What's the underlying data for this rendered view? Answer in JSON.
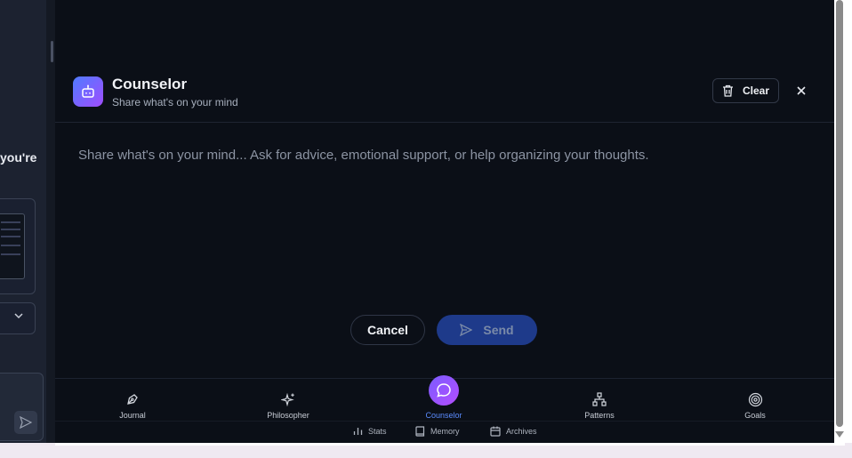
{
  "left_panel": {
    "partial_text": "you're"
  },
  "header": {
    "title": "Counselor",
    "subtitle": "Share what's on your mind",
    "clear_label": "Clear"
  },
  "composer": {
    "placeholder": "Share what's on your mind... Ask for advice, emotional support, or help organizing your thoughts.",
    "value": ""
  },
  "actions": {
    "cancel_label": "Cancel",
    "send_label": "Send"
  },
  "nav": {
    "items": [
      {
        "label": "Journal",
        "icon": "pen-nib-icon"
      },
      {
        "label": "Philosopher",
        "icon": "sparkles-icon"
      },
      {
        "label": "Counselor",
        "icon": "chat-bubble-icon",
        "active": true
      },
      {
        "label": "Patterns",
        "icon": "network-icon"
      },
      {
        "label": "Goals",
        "icon": "target-icon"
      }
    ],
    "sub_items": [
      {
        "label": "Stats",
        "icon": "bar-chart-icon"
      },
      {
        "label": "Memory",
        "icon": "book-icon"
      },
      {
        "label": "Archives",
        "icon": "calendar-icon"
      }
    ]
  },
  "colors": {
    "accent_blue": "#5b8cff",
    "send_bg": "#1e3a8a",
    "panel_bg": "#0b0f17",
    "avatar_gradient_start": "#4f7bff",
    "avatar_gradient_end": "#a04dff"
  }
}
